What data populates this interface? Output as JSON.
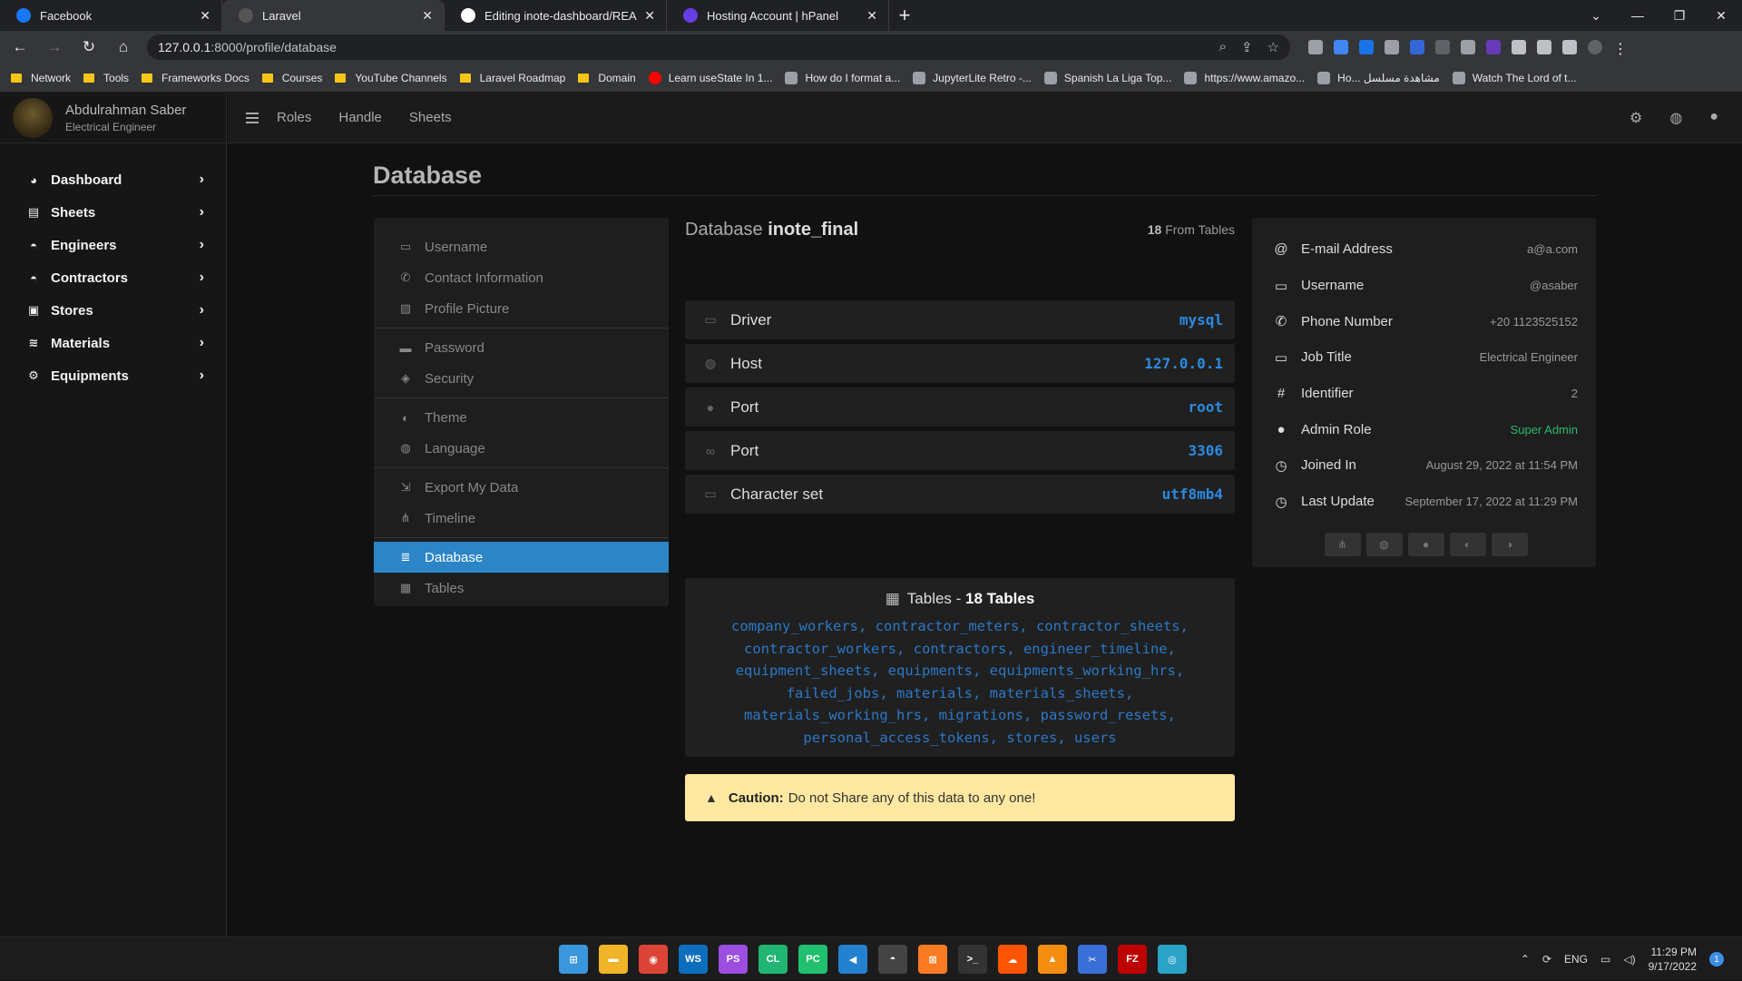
{
  "browser": {
    "tabs": [
      {
        "title": "Facebook",
        "icon": "facebook-icon",
        "color": "#1877f2",
        "active": false
      },
      {
        "title": "Laravel",
        "icon": "laravel-icon",
        "color": "#555555",
        "active": true
      },
      {
        "title": "Editing inote-dashboard/READM",
        "icon": "github-icon",
        "color": "#ffffff",
        "active": false
      },
      {
        "title": "Hosting Account | hPanel",
        "icon": "hostinger-icon",
        "color": "#673de6",
        "active": false
      }
    ],
    "url_host": "127.0.0.1",
    "url_path": ":8000/profile/database",
    "bookmarks": [
      {
        "label": "Network",
        "type": "folder"
      },
      {
        "label": "Tools",
        "type": "folder"
      },
      {
        "label": "Frameworks Docs",
        "type": "folder"
      },
      {
        "label": "Courses",
        "type": "folder"
      },
      {
        "label": "YouTube Channels",
        "type": "folder"
      },
      {
        "label": "Laravel Roadmap",
        "type": "folder"
      },
      {
        "label": "Domain",
        "type": "folder"
      },
      {
        "label": "Learn useState In 1...",
        "type": "youtube"
      },
      {
        "label": "How do I format a...",
        "type": "site"
      },
      {
        "label": "JupyterLite Retro -...",
        "type": "site"
      },
      {
        "label": "Spanish La Liga Top...",
        "type": "site"
      },
      {
        "label": "https://www.amazo...",
        "type": "site"
      },
      {
        "label": "Ho... مشاهدة مسلسل",
        "type": "site"
      },
      {
        "label": "Watch The Lord of t...",
        "type": "site"
      }
    ]
  },
  "sidebar": {
    "user_name": "Abdulrahman Saber",
    "user_role": "Electrical Engineer",
    "items": [
      {
        "label": "Dashboard",
        "icon": "dashboard-icon",
        "glyph": "◕"
      },
      {
        "label": "Sheets",
        "icon": "sheet-icon",
        "glyph": "▤"
      },
      {
        "label": "Engineers",
        "icon": "hard-hat-icon",
        "glyph": "◓"
      },
      {
        "label": "Contractors",
        "icon": "hard-hat-icon",
        "glyph": "◓"
      },
      {
        "label": "Stores",
        "icon": "store-icon",
        "glyph": "▣"
      },
      {
        "label": "Materials",
        "icon": "layers-icon",
        "glyph": "≋"
      },
      {
        "label": "Equipments",
        "icon": "equipment-icon",
        "glyph": "⚙"
      }
    ]
  },
  "topnav": {
    "links": [
      "Roles",
      "Handle",
      "Sheets"
    ]
  },
  "page": {
    "title": "Database"
  },
  "settings": {
    "groups": [
      [
        {
          "label": "Username",
          "icon": "id-card-icon",
          "glyph": "▭",
          "active": false
        },
        {
          "label": "Contact Information",
          "icon": "phone-icon",
          "glyph": "✆",
          "active": false
        },
        {
          "label": "Profile Picture",
          "icon": "image-icon",
          "glyph": "▨",
          "active": false
        }
      ],
      [
        {
          "label": "Password",
          "icon": "lock-icon",
          "glyph": "▬",
          "active": false
        },
        {
          "label": "Security",
          "icon": "shield-icon",
          "glyph": "◈",
          "active": false
        }
      ],
      [
        {
          "label": "Theme",
          "icon": "palette-icon",
          "glyph": "◐",
          "active": false
        },
        {
          "label": "Language",
          "icon": "globe-icon",
          "glyph": "◍",
          "active": false
        }
      ],
      [
        {
          "label": "Export My Data",
          "icon": "export-icon",
          "glyph": "⇲",
          "active": false
        },
        {
          "label": "Timeline",
          "icon": "timeline-icon",
          "glyph": "⋔",
          "active": false
        }
      ],
      [
        {
          "label": "Database",
          "icon": "database-icon",
          "glyph": "≣",
          "active": true
        },
        {
          "label": "Tables",
          "icon": "table-icon",
          "glyph": "▦",
          "active": false
        }
      ]
    ]
  },
  "database": {
    "title_prefix": "Database",
    "name": "inote_final",
    "count_number": "18",
    "count_suffix": "From Tables",
    "rows": [
      {
        "label": "Driver",
        "value": "mysql",
        "icon": "server-icon",
        "glyph": "▭"
      },
      {
        "label": "Host",
        "value": "127.0.0.1",
        "icon": "globe-icon",
        "glyph": "◍"
      },
      {
        "label": "Port",
        "value": "root",
        "icon": "user-icon",
        "glyph": "●"
      },
      {
        "label": "Port",
        "value": "3306",
        "icon": "link-icon",
        "glyph": "∞"
      },
      {
        "label": "Character set",
        "value": "utf8mb4",
        "icon": "keyboard-icon",
        "glyph": "▭"
      }
    ],
    "tables_label": "Tables -",
    "tables_count": "18 Tables",
    "tables_list": "company_workers, contractor_meters, contractor_sheets, contractor_workers, contractors, engineer_timeline, equipment_sheets, equipments, equipments_working_hrs, failed_jobs, materials, materials_sheets, materials_working_hrs, migrations, password_resets, personal_access_tokens, stores, users"
  },
  "caution": {
    "label": "Caution:",
    "text": "Do not Share any of this data to any one!"
  },
  "profile_info": [
    {
      "label": "E-mail Address",
      "value": "a@a.com",
      "icon": "at-icon",
      "glyph": "@",
      "green": false
    },
    {
      "label": "Username",
      "value": "@asaber",
      "icon": "id-card-icon",
      "glyph": "▭",
      "green": false
    },
    {
      "label": "Phone Number",
      "value": "+20 1123525152",
      "icon": "phone-icon",
      "glyph": "✆",
      "green": false
    },
    {
      "label": "Job Title",
      "value": "Electrical Engineer",
      "icon": "id-card-icon",
      "glyph": "▭",
      "green": false
    },
    {
      "label": "Identifier",
      "value": "2",
      "icon": "hash-icon",
      "glyph": "#",
      "green": false
    },
    {
      "label": "Admin Role",
      "value": "Super Admin",
      "icon": "user-gear-icon",
      "glyph": "●",
      "green": true
    },
    {
      "label": "Joined In",
      "value": "August 29, 2022 at 11:54 PM",
      "icon": "clock-icon",
      "glyph": "◷",
      "green": false
    },
    {
      "label": "Last Update",
      "value": "September 17, 2022 at 11:29 PM",
      "icon": "clock-icon",
      "glyph": "◷",
      "green": false
    }
  ],
  "info_buttons": [
    {
      "icon": "timeline-icon",
      "glyph": "⋔"
    },
    {
      "icon": "globe-icon",
      "glyph": "◍"
    },
    {
      "icon": "users-icon",
      "glyph": "●"
    },
    {
      "icon": "palette-icon",
      "glyph": "◐"
    },
    {
      "icon": "language-icon",
      "glyph": "◑"
    }
  ],
  "taskbar": {
    "apps": [
      {
        "name": "windows-start-icon",
        "color": "#3a96dd",
        "glyph": "⊞"
      },
      {
        "name": "file-explorer-icon",
        "color": "#f0b429",
        "glyph": "▬"
      },
      {
        "name": "chrome-icon",
        "color": "#db4437",
        "glyph": "◉"
      },
      {
        "name": "webstorm-icon",
        "color": "#0d6ebd",
        "glyph": "WS"
      },
      {
        "name": "phpstorm-icon",
        "color": "#9b4ee0",
        "glyph": "PS"
      },
      {
        "name": "clion-icon",
        "color": "#21b573",
        "glyph": "CL"
      },
      {
        "name": "pycharm-icon",
        "color": "#21c06e",
        "glyph": "PC"
      },
      {
        "name": "vscode-icon",
        "color": "#2481d0",
        "glyph": "◀"
      },
      {
        "name": "hat-app-icon",
        "color": "#444444",
        "glyph": "◓"
      },
      {
        "name": "xampp-icon",
        "color": "#fb7a24",
        "glyph": "⊠"
      },
      {
        "name": "terminal-icon",
        "color": "#333333",
        "glyph": ">_"
      },
      {
        "name": "soundcloud-icon",
        "color": "#ff5500",
        "glyph": "☁"
      },
      {
        "name": "sourcetree-icon",
        "color": "#f58d11",
        "glyph": "▲"
      },
      {
        "name": "snipping-tool-icon",
        "color": "#3a6fd8",
        "glyph": "✂"
      },
      {
        "name": "filezilla-icon",
        "color": "#bf0000",
        "glyph": "FZ"
      },
      {
        "name": "gauge-app-icon",
        "color": "#2aa3c7",
        "glyph": "◎"
      }
    ],
    "language": "ENG",
    "time": "11:29 PM",
    "date": "9/17/2022",
    "notifications": "1"
  }
}
